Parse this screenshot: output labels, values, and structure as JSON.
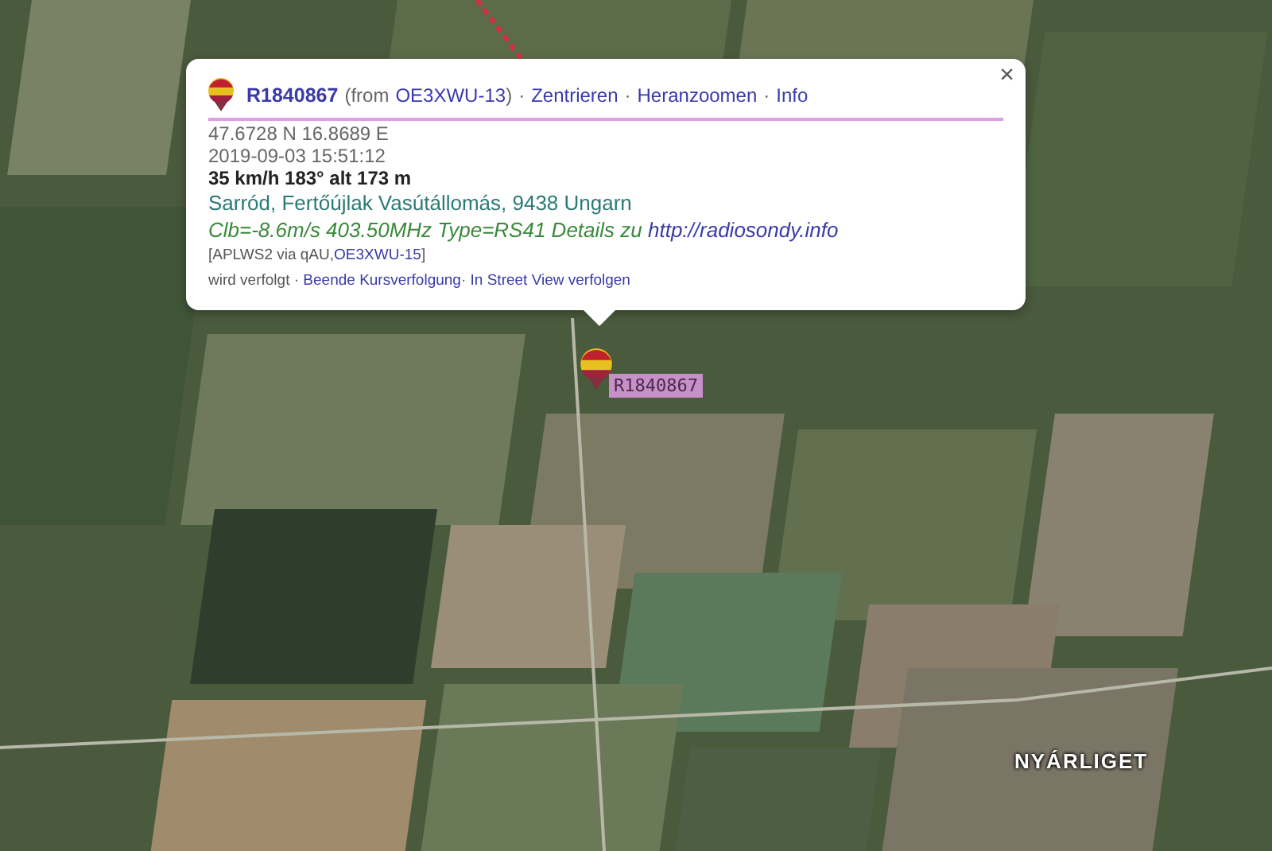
{
  "popup": {
    "close": "×",
    "title_id": "R1840867",
    "from_prefix": "(from",
    "from_call": "OE3XWU-13",
    "from_suffix": ")",
    "separator": "·",
    "links": [
      "Zentrieren",
      "Heranzoomen",
      "Info"
    ],
    "position": "47.6728 N 16.8689 E",
    "time": "2019-09-03 15:51:12",
    "motion": "35 km/h 183° alt 173 m",
    "address": "Sarród, Fertőújlak Vasútállomás, 9438 Ungarn",
    "comment": "Clb=-8.6m/s 403.50MHz Type=RS41 Details zu",
    "comment_link": "http://radiosondy.info",
    "path_prefix": "[APLWS2 via qAU,",
    "path_call": "OE3XWU-15",
    "path_suffix": "]",
    "tracking_status": "wird verfolgt",
    "tracking_links": [
      "Beende Kursverfolgung",
      "In Street View verfolgen"
    ]
  },
  "marker": {
    "label": "R1840867"
  },
  "place_label": "NYÁRLIGET"
}
